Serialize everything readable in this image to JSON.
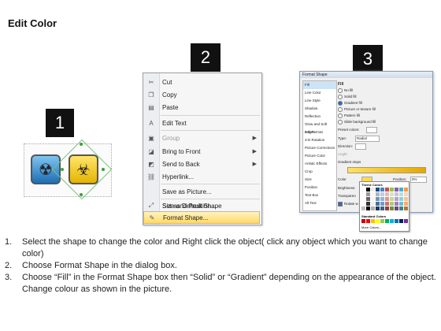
{
  "title": "Edit Color",
  "steps": {
    "one": "1",
    "two": "2",
    "three": "3"
  },
  "menu": {
    "items": [
      {
        "label": "Cut",
        "icon": "scissors-icon",
        "glyph": "✂"
      },
      {
        "label": "Copy",
        "icon": "copy-icon",
        "glyph": "❐"
      },
      {
        "label": "Paste",
        "icon": "paste-icon",
        "glyph": "▤"
      },
      {
        "label": "Edit Text",
        "icon": "edit-text-icon",
        "glyph": "A"
      },
      {
        "label": "Group",
        "icon": "group-icon",
        "glyph": "▣"
      },
      {
        "label": "Bring to Front",
        "icon": "bring-front-icon",
        "glyph": "◪"
      },
      {
        "label": "Send to Back",
        "icon": "send-back-icon",
        "glyph": "◩"
      },
      {
        "label": "Hyperlink...",
        "icon": "hyperlink-icon",
        "glyph": "⛓"
      },
      {
        "label": "Save as Picture...",
        "icon": "",
        "glyph": ""
      },
      {
        "label": "Set as Default Shape",
        "icon": "",
        "glyph": ""
      },
      {
        "label": "Size and Position...",
        "icon": "size-position-icon",
        "glyph": "⤢"
      },
      {
        "label": "Format Shape...",
        "icon": "format-shape-icon",
        "glyph": "✎"
      }
    ]
  },
  "dialog": {
    "title": "Format Shape",
    "categories": [
      "Fill",
      "Line Color",
      "Line Style",
      "Shadow",
      "Reflection",
      "Glow and Soft Edges",
      "3-D Format",
      "3-D Rotation",
      "Picture Corrections",
      "Picture Color",
      "Artistic Effects",
      "Crop",
      "Size",
      "Position",
      "Text Box",
      "Alt Text"
    ],
    "fill_heading": "Fill",
    "fill_options": [
      "No fill",
      "Solid fill",
      "Gradient fill",
      "Picture or texture fill",
      "Pattern fill",
      "Slide background fill"
    ],
    "preset_colors": "Preset colors:",
    "type_label": "Type:",
    "type_value": "Radial",
    "direction_label": "Direction:",
    "angle_label": "Angle:",
    "gradient_stops": "Gradient stops",
    "color_label": "Color",
    "position_label": "Position:",
    "position_value": "0%",
    "brightness_label": "Brightness:",
    "transparency_label": "Transparen",
    "rotate_label": "Rotate w"
  },
  "palette": {
    "theme_label": "Theme Colors",
    "standard_label": "Standard Colors",
    "more_colors": "More Colors...",
    "theme_row": [
      "#ffffff",
      "#000000",
      "#eeece1",
      "#1f497d",
      "#4f81bd",
      "#c0504d",
      "#9bbb59",
      "#8064a2",
      "#4bacc6",
      "#f79646"
    ],
    "standard_row": [
      "#c00000",
      "#ff0000",
      "#ffc000",
      "#ffff00",
      "#92d050",
      "#00b050",
      "#00b0f0",
      "#0070c0",
      "#002060",
      "#7030a0"
    ]
  },
  "instructions": [
    {
      "num": "1.",
      "text": "Select the shape to change the color and Right click the object( click any object which you want to change color)"
    },
    {
      "num": "2.",
      "text": "Choose Format Shape in the dialog box."
    },
    {
      "num": "3.",
      "text": "Choose “Fill” in the Format Shape box then “Solid” or “Gradient” depending on the appearance of the object. Change colour as shown in the picture."
    }
  ]
}
